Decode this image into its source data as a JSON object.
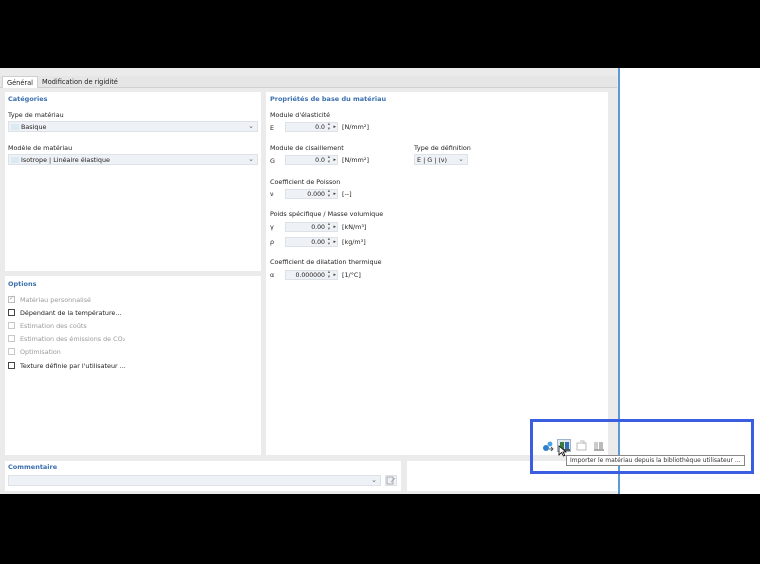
{
  "tabs": [
    {
      "label": "Général"
    },
    {
      "label": "Modification de rigidité"
    }
  ],
  "categories": {
    "title": "Catégories",
    "material_type_label": "Type de matériau",
    "material_type_value": "Basique",
    "material_model_label": "Modèle de matériau",
    "material_model_value": "Isotrope | Linéaire élastique"
  },
  "options": {
    "title": "Options",
    "items": [
      {
        "label": "Matériau personnalisé",
        "checked": true,
        "enabled": false
      },
      {
        "label": "Dépendant de la température...",
        "checked": false,
        "enabled": true
      },
      {
        "label": "Estimation des coûts",
        "checked": false,
        "enabled": false
      },
      {
        "label": "Estimation des émissions de CO₂",
        "checked": false,
        "enabled": false
      },
      {
        "label": "Optimisation",
        "checked": false,
        "enabled": false
      },
      {
        "label": "Texture définie par l'utilisateur ...",
        "checked": false,
        "enabled": true
      }
    ]
  },
  "properties": {
    "title": "Propriétés de base du matériau",
    "elastic_modulus": {
      "group": "Module d'élasticité",
      "symbol": "E",
      "value": "0.0",
      "unit": "[N/mm²]"
    },
    "shear_modulus": {
      "group": "Module de cisaillement",
      "symbol": "G",
      "value": "0.0",
      "unit": "[N/mm²]"
    },
    "definition_type": {
      "label": "Type de définition",
      "value": "E | G | (ν)"
    },
    "poisson": {
      "group": "Coefficient de Poisson",
      "symbol": "ν",
      "value": "0.000",
      "unit": "[--]"
    },
    "weight": {
      "group": "Poids spécifique / Masse volumique",
      "gamma": {
        "symbol": "γ",
        "value": "0.00",
        "unit": "[kN/m³]"
      },
      "rho": {
        "symbol": "ρ",
        "value": "0.00",
        "unit": "[kg/m³]"
      }
    },
    "thermal": {
      "group": "Coefficient de dilatation thermique",
      "symbol": "α",
      "value": "0.000000",
      "unit": "[1/°C]"
    }
  },
  "comment": {
    "title": "Commentaire",
    "value": ""
  },
  "toolbar": {
    "tooltip": "Importer le matériau depuis la bibliothèque utilisateur ...",
    "buttons": [
      {
        "icon": "library-import-icon"
      },
      {
        "icon": "user-library-icon"
      },
      {
        "icon": "save-library-icon"
      },
      {
        "icon": "library-manage-icon"
      }
    ]
  },
  "colors": {
    "accent": "#3b5ee0",
    "section_title": "#3a6fae",
    "separator": "#5a9bd6"
  }
}
